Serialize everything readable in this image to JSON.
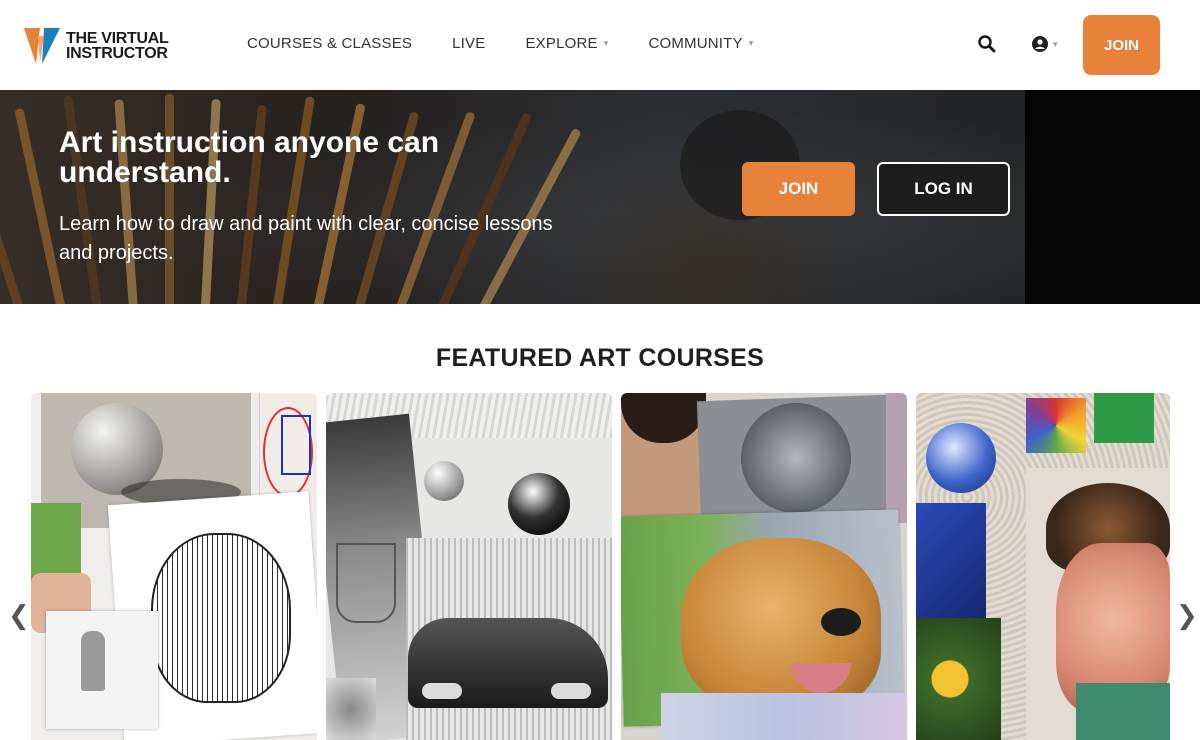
{
  "header": {
    "logo_line1": "THE VIRTUAL",
    "logo_line2": "INSTRUCTOR",
    "nav": [
      {
        "label": "COURSES & CLASSES",
        "has_dropdown": false
      },
      {
        "label": "LIVE",
        "has_dropdown": false
      },
      {
        "label": "EXPLORE",
        "has_dropdown": true
      },
      {
        "label": "COMMUNITY",
        "has_dropdown": true
      }
    ],
    "join_label": "JOIN",
    "chevron": "⌄"
  },
  "hero": {
    "title": "Art instruction anyone can understand.",
    "subtitle": "Learn how to draw and paint with clear, concise lessons and projects.",
    "join_label": "JOIN",
    "login_label": "LOG IN"
  },
  "featured": {
    "title": "FEATURED ART COURSES",
    "prev_glyph": "❮",
    "next_glyph": "❯"
  },
  "colors": {
    "accent": "#e8813a",
    "logo_blue": "#1e7fc0",
    "text_dark": "#1f1f1f"
  }
}
